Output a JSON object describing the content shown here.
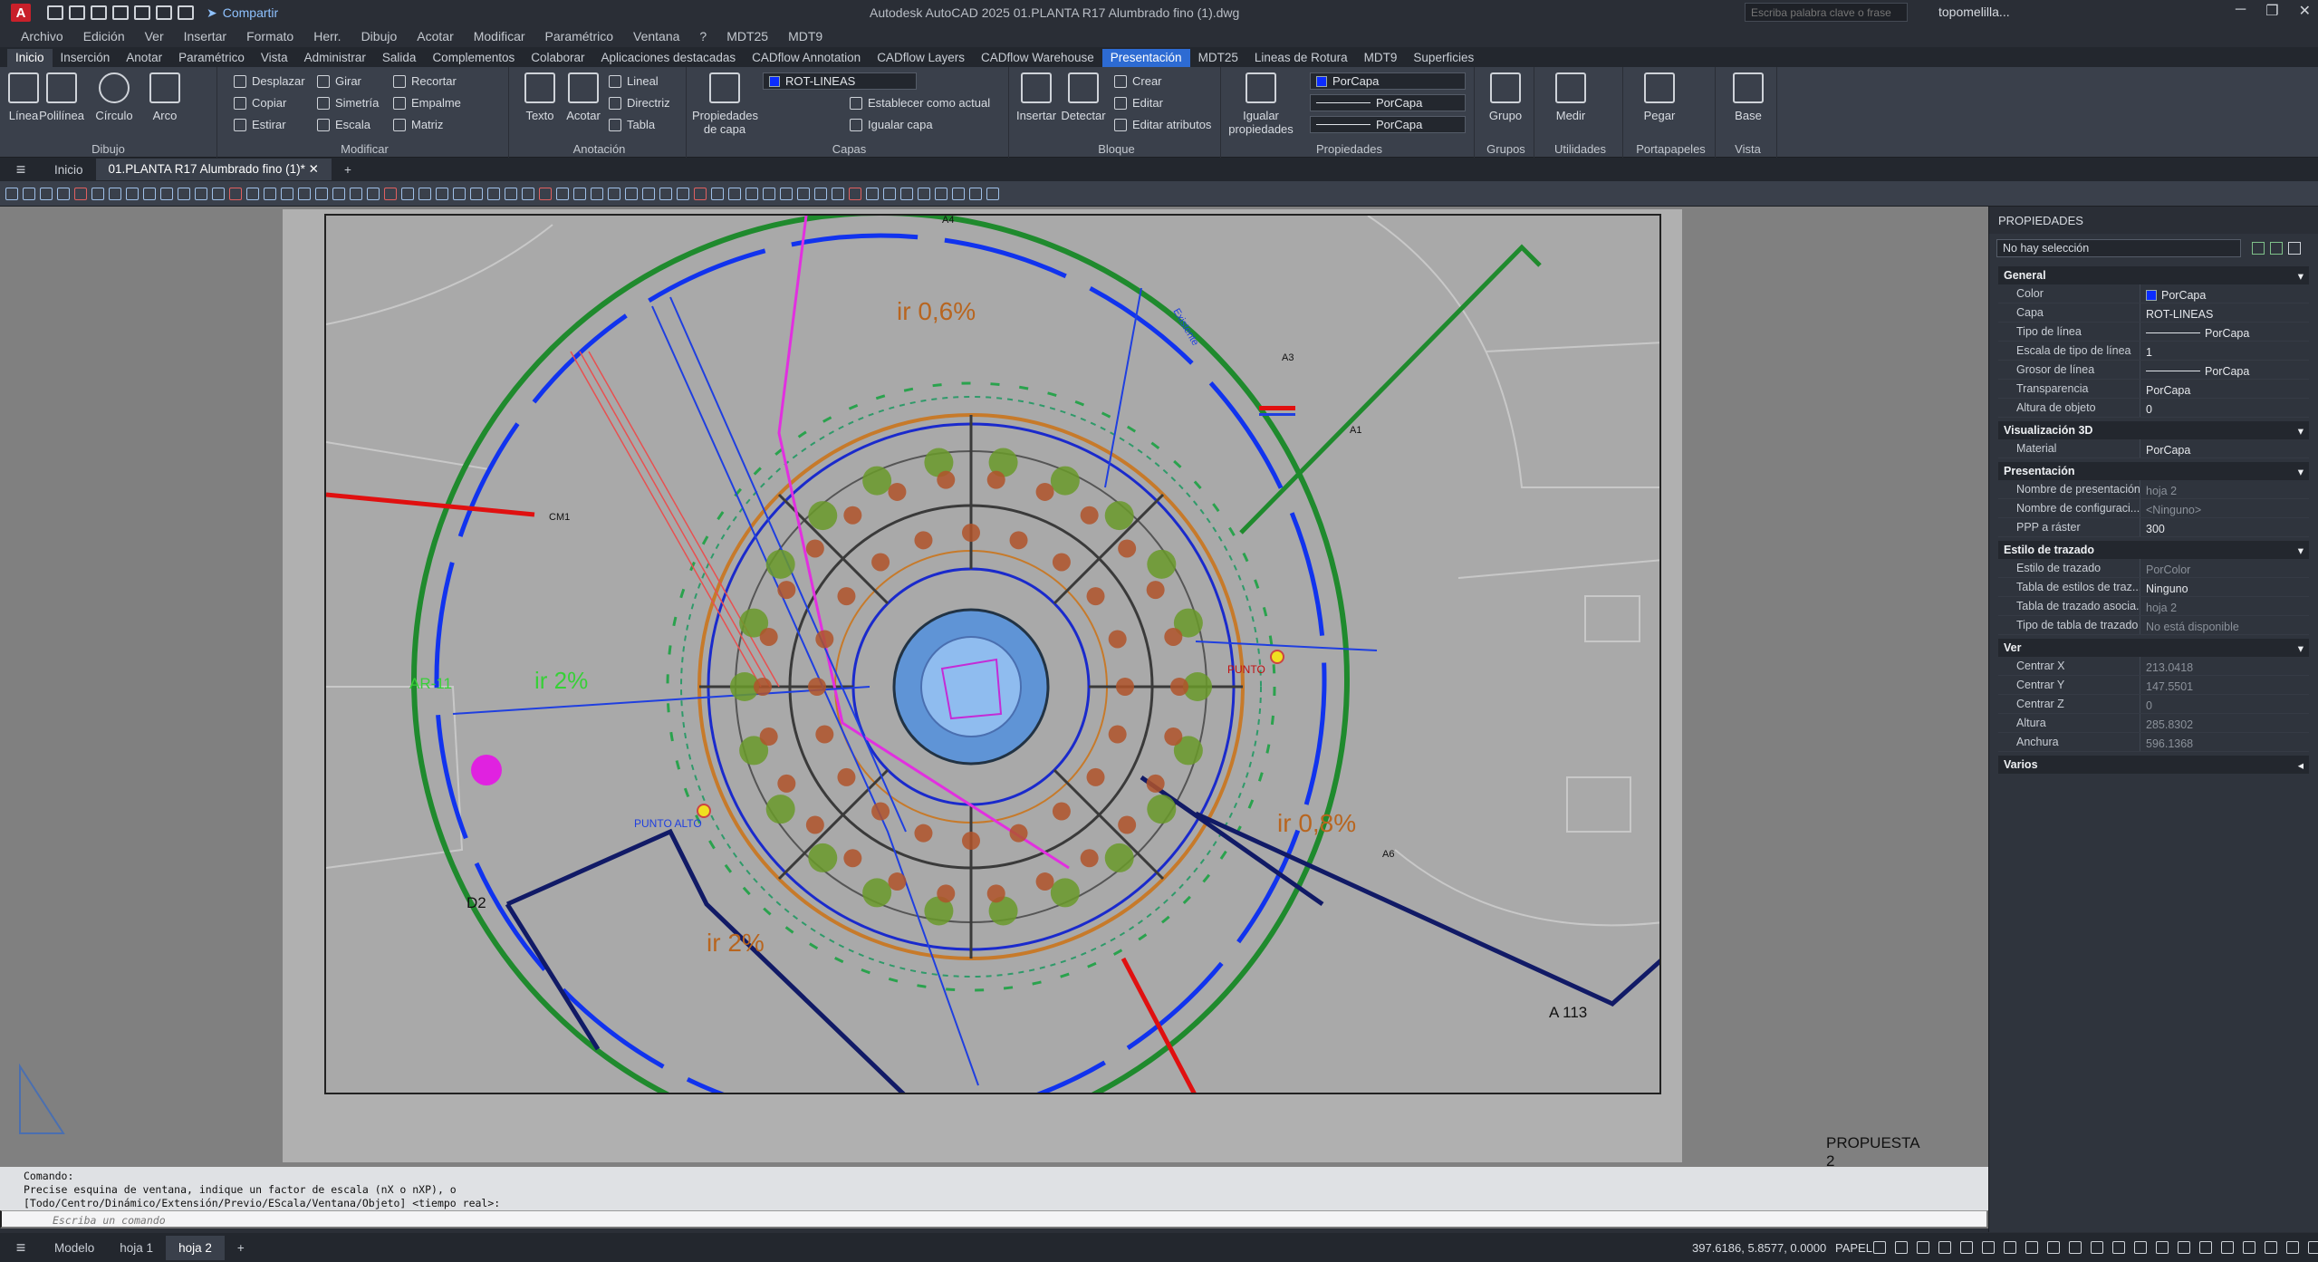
{
  "app": {
    "title": "Autodesk AutoCAD 2025    01.PLANTA R17 Alumbrado fino (1).dwg",
    "share_label": "Compartir",
    "search_placeholder": "Escriba palabra clave o frase",
    "user": "topomelilla...",
    "logo_letter": "A"
  },
  "menu": [
    "Archivo",
    "Edición",
    "Ver",
    "Insertar",
    "Formato",
    "Herr.",
    "Dibujo",
    "Acotar",
    "Modificar",
    "Paramétrico",
    "Ventana",
    "?",
    "MDT25",
    "MDT9"
  ],
  "ribbon_tabs": [
    "Inicio",
    "Inserción",
    "Anotar",
    "Paramétrico",
    "Vista",
    "Administrar",
    "Salida",
    "Complementos",
    "Colaborar",
    "Aplicaciones destacadas",
    "CADflow Annotation",
    "CADflow Layers",
    "CADflow Warehouse",
    "Presentación",
    "MDT25",
    "Lineas de Rotura",
    "MDT9",
    "Superficies"
  ],
  "ribbon": {
    "dibujo": {
      "label": "Dibujo",
      "tools": [
        "Línea",
        "Polilínea",
        "Círculo",
        "Arco"
      ]
    },
    "modificar": {
      "label": "Modificar",
      "tools": [
        "Desplazar",
        "Girar",
        "Recortar",
        "Copiar",
        "Simetría",
        "Empalme",
        "Estirar",
        "Escala",
        "Matriz"
      ]
    },
    "anotacion": {
      "label": "Anotación",
      "texto": "Texto",
      "acotar": "Acotar",
      "tools": [
        "Lineal",
        "Directriz",
        "Tabla"
      ]
    },
    "capas": {
      "label": "Capas",
      "propiedades": "Propiedades de capa",
      "layer": "ROT-LINEAS",
      "tools": [
        "Establecer como actual",
        "Igualar capa"
      ]
    },
    "bloque": {
      "label": "Bloque",
      "insertar": "Insertar",
      "detectar": "Detectar",
      "tools": [
        "Crear",
        "Editar",
        "Editar atributos"
      ]
    },
    "propiedades": {
      "label": "Propiedades",
      "igualar": "Igualar propiedades",
      "combos": [
        "PorCapa",
        "PorCapa",
        "PorCapa"
      ]
    },
    "grupos": {
      "label": "Grupos",
      "grupo": "Grupo"
    },
    "utilidades": {
      "label": "Utilidades",
      "medir": "Medir"
    },
    "portapapeles": {
      "label": "Portapapeles",
      "pegar": "Pegar"
    },
    "vista": {
      "label": "Vista",
      "base": "Base"
    }
  },
  "doc_tabs": {
    "home": "Inicio",
    "active": "01.PLANTA R17 Alumbrado fino (1)*"
  },
  "drawing": {
    "labels": {
      "ir06": "ir 0,6%",
      "ir08": "ir 0,8%",
      "ir2a": "ir 2%",
      "ir2b": "ir 2%",
      "a113": "A 113",
      "d2": "D2",
      "ar11": "AR-11",
      "punto": "PUNTO",
      "punto_alto": "PUNTO ALTO",
      "existente": "Existente",
      "a1": "A1",
      "a3": "A3",
      "a4": "A4",
      "a6": "A6",
      "cm1": "CM1"
    },
    "propuesta": "PROPUESTA 2"
  },
  "properties": {
    "header": "PROPIEDADES",
    "selection": "No hay selección",
    "sections": [
      {
        "title": "General",
        "rows": [
          {
            "k": "Color",
            "v": "PorCapa"
          },
          {
            "k": "Capa",
            "v": "ROT-LINEAS"
          },
          {
            "k": "Tipo de línea",
            "v": "PorCapa"
          },
          {
            "k": "Escala de tipo de línea",
            "v": "1"
          },
          {
            "k": "Grosor de línea",
            "v": "PorCapa"
          },
          {
            "k": "Transparencia",
            "v": "PorCapa"
          },
          {
            "k": "Altura de objeto",
            "v": "0"
          }
        ]
      },
      {
        "title": "Visualización 3D",
        "rows": [
          {
            "k": "Material",
            "v": "PorCapa"
          }
        ]
      },
      {
        "title": "Presentación",
        "rows": [
          {
            "k": "Nombre de presentación",
            "v": "hoja 2"
          },
          {
            "k": "Nombre de configuraci...",
            "v": "<Ninguno>"
          },
          {
            "k": "PPP a ráster",
            "v": "300"
          }
        ]
      },
      {
        "title": "Estilo de trazado",
        "rows": [
          {
            "k": "Estilo de trazado",
            "v": "PorColor"
          },
          {
            "k": "Tabla de estilos de traz...",
            "v": "Ninguno"
          },
          {
            "k": "Tabla de trazado asocia...",
            "v": "hoja 2"
          },
          {
            "k": "Tipo de tabla de trazado",
            "v": "No está disponible"
          }
        ]
      },
      {
        "title": "Ver",
        "rows": [
          {
            "k": "Centrar X",
            "v": "213.0418"
          },
          {
            "k": "Centrar Y",
            "v": "147.5501"
          },
          {
            "k": "Centrar Z",
            "v": "0"
          },
          {
            "k": "Altura",
            "v": "285.8302"
          },
          {
            "k": "Anchura",
            "v": "596.1368"
          }
        ]
      },
      {
        "title": "Varios",
        "rows": []
      }
    ]
  },
  "command": {
    "line1": "Comando:",
    "line2": "Precise esquina de ventana, indique un factor de escala (nX o nXP), o",
    "line3": "[Todo/Centro/Dinámico/Extensión/Previo/EScala/Ventana/Objeto] <tiempo real>:",
    "placeholder": "Escriba un comando"
  },
  "status": {
    "tabs": [
      "Modelo",
      "hoja 1",
      "hoja 2"
    ],
    "coords": "397.6186, 5.8577, 0.0000",
    "space": "PAPEL"
  }
}
